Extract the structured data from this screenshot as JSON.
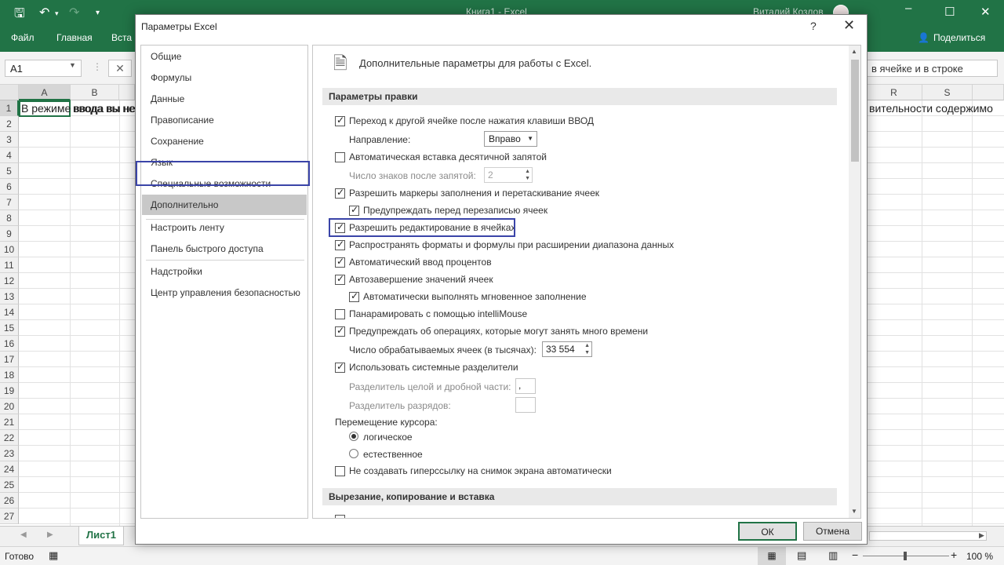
{
  "excel": {
    "window_title": "Книга1 - Excel",
    "user_name": "Виталий Козлов",
    "ribbon_tabs": [
      "Файл",
      "Главная",
      "Вста"
    ],
    "share_label": "Поделиться",
    "namebox_value": "A1",
    "formula_visible": "в ячейке и в строке",
    "columns": [
      "A",
      "B",
      "R",
      "S"
    ],
    "rows": [
      "1",
      "2",
      "3",
      "4",
      "5",
      "6",
      "7",
      "8",
      "9",
      "10",
      "11",
      "12",
      "13",
      "14",
      "15",
      "16",
      "17",
      "18",
      "19",
      "20",
      "21",
      "22",
      "23",
      "24",
      "25",
      "26",
      "27"
    ],
    "cell_a1_text": "В режиме ввода вы не",
    "cell_b1_text": "ввода вы не",
    "cell_r1_text": "вительности содержимо",
    "sheet_tab": "Лист1",
    "status_ready": "Готово",
    "zoom": "100 %"
  },
  "dialog": {
    "title": "Параметры Excel",
    "help": "?",
    "nav_items": [
      "Общие",
      "Формулы",
      "Данные",
      "Правописание",
      "Сохранение",
      "Язык",
      "Специальные возможности",
      "Дополнительно",
      "Настроить ленту",
      "Панель быстрого доступа",
      "Надстройки",
      "Центр управления безопасностью"
    ],
    "selected_nav": "Дополнительно",
    "header_text": "Дополнительные параметры для работы с Excel.",
    "section_edit": "Параметры правки",
    "section_cut": "Вырезание, копирование и вставка",
    "options": {
      "move_after_enter": "Переход к другой ячейке после нажатия клавиши ВВОД",
      "direction_label": "Направление:",
      "direction_value": "Вправо",
      "auto_decimal": "Автоматическая вставка десятичной запятой",
      "decimal_places_label": "Число знаков после запятой:",
      "decimal_places_value": "2",
      "fill_handle": "Разрешить маркеры заполнения и перетаскивание ячеек",
      "warn_overwrite": "Предупреждать перед перезаписью ячеек",
      "edit_in_cell": "Разрешить редактирование в ячейках",
      "extend_formats": "Распространять форматы и формулы при расширении диапазона данных",
      "auto_percent": "Автоматический ввод процентов",
      "autocomplete": "Автозавершение значений ячеек",
      "flash_fill": "Автоматически выполнять мгновенное заполнение",
      "intellimouse": "Панарамировать с помощью intelliMouse",
      "warn_long_ops": "Предупреждать об операциях, которые могут занять много времени",
      "cells_count_label": "Число обрабатываемых ячеек (в тысячах):",
      "cells_count_value": "33 554",
      "system_separators": "Использовать системные разделители",
      "decimal_sep_label": "Разделитель целой и дробной части:",
      "decimal_sep_value": ",",
      "thousands_sep_label": "Разделитель разрядов:",
      "thousands_sep_value": "",
      "cursor_movement_label": "Перемещение курсора:",
      "cursor_logical": "логическое",
      "cursor_visual": "естественное",
      "no_hyperlink": "Не создавать гиперссылку на снимок экрана автоматически"
    },
    "ok_label": "ОК",
    "cancel_label": "Отмена"
  },
  "colors": {
    "excel_green": "#217346",
    "highlight_blue": "#3a44a8",
    "selected_nav_bg": "#c8c8c8"
  }
}
